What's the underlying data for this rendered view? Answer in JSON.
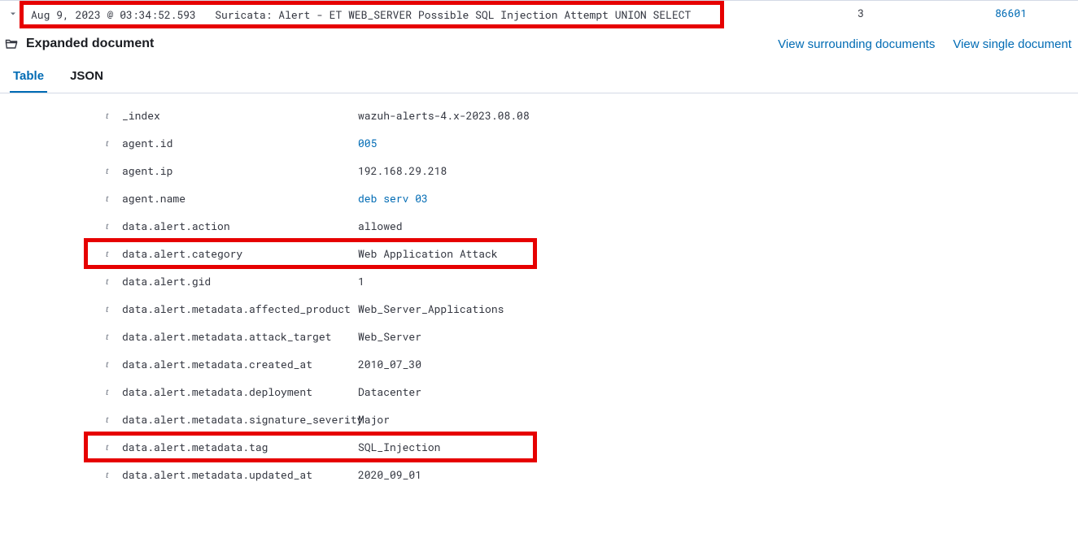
{
  "header": {
    "timestamp": "Aug 9, 2023 @ 03:34:52.593",
    "source": "Suricata: Alert - ET WEB_SERVER Possible SQL Injection Attempt UNION SELECT",
    "col1": "3",
    "col2": "86601"
  },
  "doc": {
    "title": "Expanded document",
    "surrounding": "View surrounding documents",
    "single": "View single document"
  },
  "tabs": {
    "table": "Table",
    "json": "JSON"
  },
  "fields": [
    {
      "type": "t",
      "key": "_index",
      "value": "wazuh-alerts-4.x-2023.08.08",
      "link": false,
      "boxed": false
    },
    {
      "type": "t",
      "key": "agent.id",
      "value": "005",
      "link": true,
      "boxed": false
    },
    {
      "type": "t",
      "key": "agent.ip",
      "value": "192.168.29.218",
      "link": false,
      "boxed": false
    },
    {
      "type": "t",
      "key": "agent.name",
      "value": "deb serv 03",
      "link": true,
      "boxed": false
    },
    {
      "type": "t",
      "key": "data.alert.action",
      "value": "allowed",
      "link": false,
      "boxed": false
    },
    {
      "type": "t",
      "key": "data.alert.category",
      "value": "Web Application Attack",
      "link": false,
      "boxed": true
    },
    {
      "type": "t",
      "key": "data.alert.gid",
      "value": "1",
      "link": false,
      "boxed": false
    },
    {
      "type": "t",
      "key": "data.alert.metadata.affected_product",
      "value": "Web_Server_Applications",
      "link": false,
      "boxed": false
    },
    {
      "type": "t",
      "key": "data.alert.metadata.attack_target",
      "value": "Web_Server",
      "link": false,
      "boxed": false
    },
    {
      "type": "t",
      "key": "data.alert.metadata.created_at",
      "value": "2010_07_30",
      "link": false,
      "boxed": false
    },
    {
      "type": "t",
      "key": "data.alert.metadata.deployment",
      "value": "Datacenter",
      "link": false,
      "boxed": false
    },
    {
      "type": "t",
      "key": "data.alert.metadata.signature_severity",
      "value": "Major",
      "link": false,
      "boxed": false
    },
    {
      "type": "t",
      "key": "data.alert.metadata.tag",
      "value": "SQL_Injection",
      "link": false,
      "boxed": true
    },
    {
      "type": "t",
      "key": "data.alert.metadata.updated_at",
      "value": "2020_09_01",
      "link": false,
      "boxed": false
    }
  ]
}
